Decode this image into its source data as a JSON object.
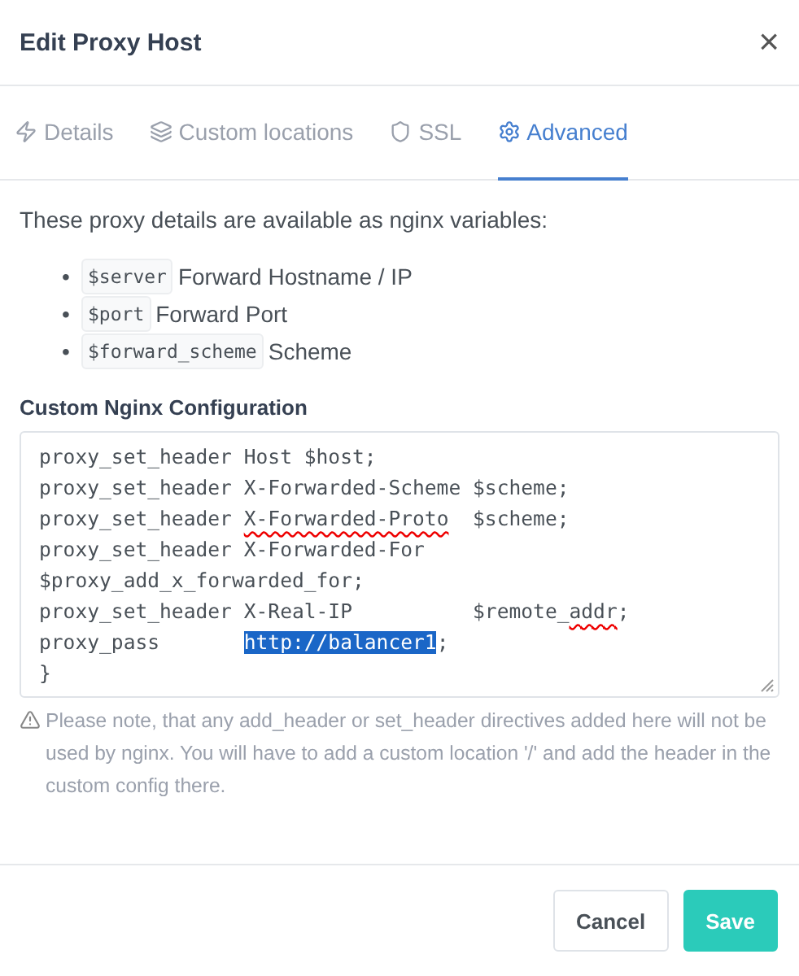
{
  "dialog": {
    "title": "Edit Proxy Host",
    "close": "×"
  },
  "tabs": [
    {
      "label": "Details",
      "kind": "zap",
      "selected": false
    },
    {
      "label": "Custom locations",
      "kind": "layers",
      "selected": false
    },
    {
      "label": "SSL",
      "kind": "shield",
      "selected": false
    },
    {
      "label": "Advanced",
      "kind": "gear",
      "selected": true
    }
  ],
  "intro": "These proxy details are available as nginx variables:",
  "variables": [
    {
      "bullet": "•",
      "code": "$server",
      "label": "Forward Hostname / IP"
    },
    {
      "bullet": "•",
      "code": "$port",
      "label": "Forward Port"
    },
    {
      "bullet": "•",
      "code": "$forward_scheme",
      "label": "Scheme"
    }
  ],
  "config": {
    "label": "Custom Nginx Configuration",
    "lines": [
      [
        {
          "text": "proxy_set_header Host $host;",
          "kind": "plain"
        }
      ],
      [
        {
          "text": "proxy_set_header X-Forwarded-Scheme $scheme;",
          "kind": "plain"
        }
      ],
      [
        {
          "text": "proxy_set_header ",
          "kind": "plain"
        },
        {
          "text": "X-Forwarded-Proto",
          "kind": "misspelled"
        },
        {
          "text": "  $scheme;",
          "kind": "plain"
        }
      ],
      [
        {
          "text": "proxy_set_header X-Forwarded-For",
          "kind": "plain"
        }
      ],
      [
        {
          "text": "$proxy_add_x_forwarded_for;",
          "kind": "plain"
        }
      ],
      [
        {
          "text": "proxy_set_header X-Real-IP          $remote_",
          "kind": "plain"
        },
        {
          "text": "addr",
          "kind": "misspelled"
        },
        {
          "text": ";",
          "kind": "plain"
        }
      ],
      [
        {
          "text": "proxy_pass       ",
          "kind": "plain"
        },
        {
          "text": "http://balancer1",
          "kind": "selected"
        },
        {
          "text": ";",
          "kind": "plain"
        }
      ],
      [
        {
          "text": "}",
          "kind": "plain"
        }
      ]
    ]
  },
  "note": "Please note, that any add_header or set_header directives added here will not be used by nginx. You will have to add a custom location '/' and add the header in the custom config there.",
  "buttons": [
    {
      "label": "Cancel",
      "kind": "secondary"
    },
    {
      "label": "Save",
      "kind": "primary"
    }
  ]
}
